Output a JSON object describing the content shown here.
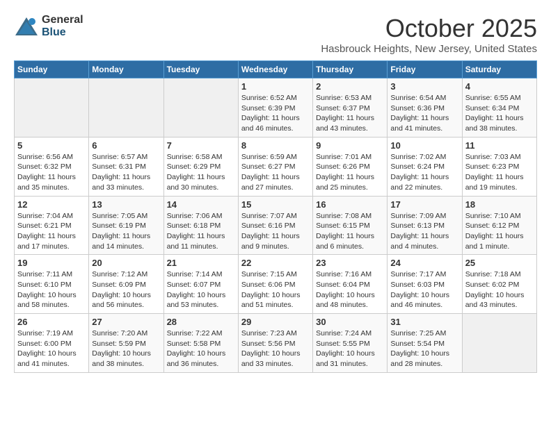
{
  "logo": {
    "general": "General",
    "blue": "Blue"
  },
  "title": "October 2025",
  "subtitle": "Hasbrouck Heights, New Jersey, United States",
  "days_of_week": [
    "Sunday",
    "Monday",
    "Tuesday",
    "Wednesday",
    "Thursday",
    "Friday",
    "Saturday"
  ],
  "weeks": [
    [
      {
        "day": "",
        "info": ""
      },
      {
        "day": "",
        "info": ""
      },
      {
        "day": "",
        "info": ""
      },
      {
        "day": "1",
        "info": "Sunrise: 6:52 AM\nSunset: 6:39 PM\nDaylight: 11 hours and 46 minutes."
      },
      {
        "day": "2",
        "info": "Sunrise: 6:53 AM\nSunset: 6:37 PM\nDaylight: 11 hours and 43 minutes."
      },
      {
        "day": "3",
        "info": "Sunrise: 6:54 AM\nSunset: 6:36 PM\nDaylight: 11 hours and 41 minutes."
      },
      {
        "day": "4",
        "info": "Sunrise: 6:55 AM\nSunset: 6:34 PM\nDaylight: 11 hours and 38 minutes."
      }
    ],
    [
      {
        "day": "5",
        "info": "Sunrise: 6:56 AM\nSunset: 6:32 PM\nDaylight: 11 hours and 35 minutes."
      },
      {
        "day": "6",
        "info": "Sunrise: 6:57 AM\nSunset: 6:31 PM\nDaylight: 11 hours and 33 minutes."
      },
      {
        "day": "7",
        "info": "Sunrise: 6:58 AM\nSunset: 6:29 PM\nDaylight: 11 hours and 30 minutes."
      },
      {
        "day": "8",
        "info": "Sunrise: 6:59 AM\nSunset: 6:27 PM\nDaylight: 11 hours and 27 minutes."
      },
      {
        "day": "9",
        "info": "Sunrise: 7:01 AM\nSunset: 6:26 PM\nDaylight: 11 hours and 25 minutes."
      },
      {
        "day": "10",
        "info": "Sunrise: 7:02 AM\nSunset: 6:24 PM\nDaylight: 11 hours and 22 minutes."
      },
      {
        "day": "11",
        "info": "Sunrise: 7:03 AM\nSunset: 6:23 PM\nDaylight: 11 hours and 19 minutes."
      }
    ],
    [
      {
        "day": "12",
        "info": "Sunrise: 7:04 AM\nSunset: 6:21 PM\nDaylight: 11 hours and 17 minutes."
      },
      {
        "day": "13",
        "info": "Sunrise: 7:05 AM\nSunset: 6:19 PM\nDaylight: 11 hours and 14 minutes."
      },
      {
        "day": "14",
        "info": "Sunrise: 7:06 AM\nSunset: 6:18 PM\nDaylight: 11 hours and 11 minutes."
      },
      {
        "day": "15",
        "info": "Sunrise: 7:07 AM\nSunset: 6:16 PM\nDaylight: 11 hours and 9 minutes."
      },
      {
        "day": "16",
        "info": "Sunrise: 7:08 AM\nSunset: 6:15 PM\nDaylight: 11 hours and 6 minutes."
      },
      {
        "day": "17",
        "info": "Sunrise: 7:09 AM\nSunset: 6:13 PM\nDaylight: 11 hours and 4 minutes."
      },
      {
        "day": "18",
        "info": "Sunrise: 7:10 AM\nSunset: 6:12 PM\nDaylight: 11 hours and 1 minute."
      }
    ],
    [
      {
        "day": "19",
        "info": "Sunrise: 7:11 AM\nSunset: 6:10 PM\nDaylight: 10 hours and 58 minutes."
      },
      {
        "day": "20",
        "info": "Sunrise: 7:12 AM\nSunset: 6:09 PM\nDaylight: 10 hours and 56 minutes."
      },
      {
        "day": "21",
        "info": "Sunrise: 7:14 AM\nSunset: 6:07 PM\nDaylight: 10 hours and 53 minutes."
      },
      {
        "day": "22",
        "info": "Sunrise: 7:15 AM\nSunset: 6:06 PM\nDaylight: 10 hours and 51 minutes."
      },
      {
        "day": "23",
        "info": "Sunrise: 7:16 AM\nSunset: 6:04 PM\nDaylight: 10 hours and 48 minutes."
      },
      {
        "day": "24",
        "info": "Sunrise: 7:17 AM\nSunset: 6:03 PM\nDaylight: 10 hours and 46 minutes."
      },
      {
        "day": "25",
        "info": "Sunrise: 7:18 AM\nSunset: 6:02 PM\nDaylight: 10 hours and 43 minutes."
      }
    ],
    [
      {
        "day": "26",
        "info": "Sunrise: 7:19 AM\nSunset: 6:00 PM\nDaylight: 10 hours and 41 minutes."
      },
      {
        "day": "27",
        "info": "Sunrise: 7:20 AM\nSunset: 5:59 PM\nDaylight: 10 hours and 38 minutes."
      },
      {
        "day": "28",
        "info": "Sunrise: 7:22 AM\nSunset: 5:58 PM\nDaylight: 10 hours and 36 minutes."
      },
      {
        "day": "29",
        "info": "Sunrise: 7:23 AM\nSunset: 5:56 PM\nDaylight: 10 hours and 33 minutes."
      },
      {
        "day": "30",
        "info": "Sunrise: 7:24 AM\nSunset: 5:55 PM\nDaylight: 10 hours and 31 minutes."
      },
      {
        "day": "31",
        "info": "Sunrise: 7:25 AM\nSunset: 5:54 PM\nDaylight: 10 hours and 28 minutes."
      },
      {
        "day": "",
        "info": ""
      }
    ]
  ]
}
